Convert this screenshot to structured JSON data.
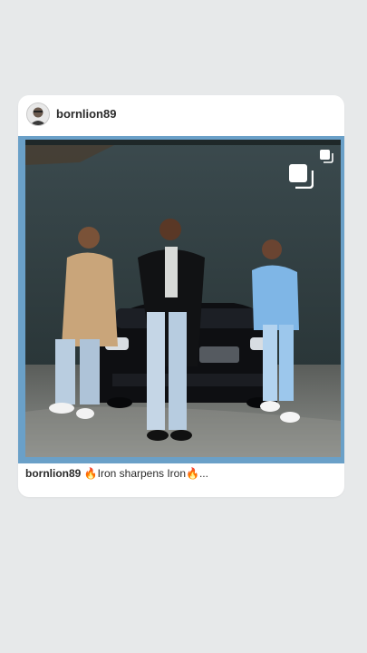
{
  "post": {
    "username": "bornlion89",
    "caption_username": "bornlion89",
    "caption_text": "🔥Iron sharpens Iron🔥...",
    "icons": {
      "avatar": "profile-avatar",
      "multi": "multiple-images-icon",
      "gallery": "gallery-icon"
    }
  }
}
